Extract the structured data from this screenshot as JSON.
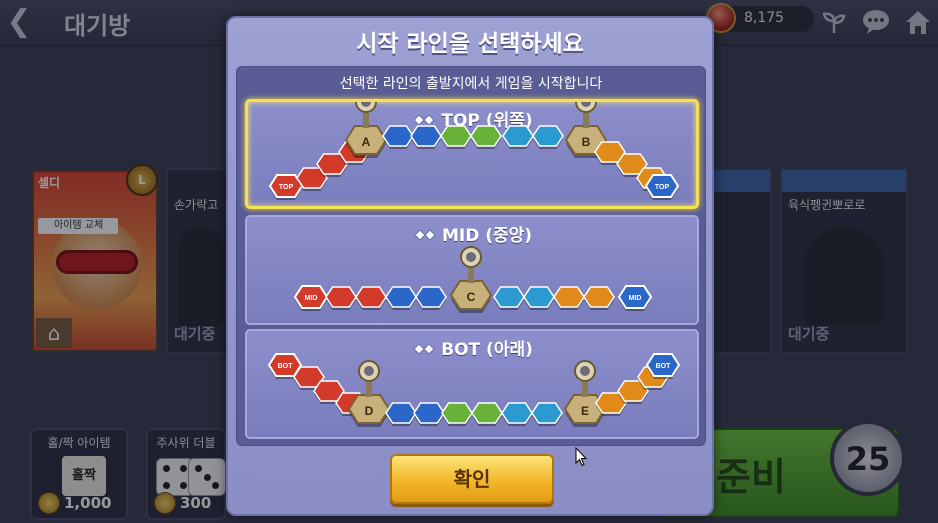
{
  "header": {
    "back_icon": "chevron-left-icon",
    "title": "대기방",
    "gem_amount": "8,175",
    "icons": [
      "sprout-icon",
      "chat-bubble-icon",
      "home-icon"
    ]
  },
  "players": [
    {
      "name": "셀디",
      "swap_label": "아이템 교체",
      "level_badge": "lv-icon"
    },
    {
      "name": "손가락고",
      "status": "대기중"
    },
    {
      "name": "육식펭귄뽀로로",
      "status": "대기중"
    }
  ],
  "items": {
    "oddeven": {
      "title": "홀/짝 아이템",
      "card": "홀짝",
      "price": "1,000"
    },
    "dice": {
      "title": "주사위 더블",
      "price": "300"
    }
  },
  "ready": {
    "label": "준비",
    "timer": "25"
  },
  "modal": {
    "title": "시작 라인을 선택하세요",
    "subtitle": "선택한 라인의 출발지에서 게임을 시작합니다",
    "lanes": [
      {
        "id": "top",
        "label": "TOP (위쪽)",
        "selected": true,
        "start_tag": "TOP",
        "end_tag": "TOP",
        "bases": [
          "A",
          "B"
        ]
      },
      {
        "id": "mid",
        "label": "MID (중앙)",
        "selected": false,
        "start_tag": "MID",
        "end_tag": "MID",
        "bases": [
          "C"
        ]
      },
      {
        "id": "bot",
        "label": "BOT (아래)",
        "selected": false,
        "start_tag": "BOT",
        "end_tag": "BOT",
        "bases": [
          "D",
          "E"
        ]
      }
    ],
    "confirm_label": "확인"
  },
  "colors": {
    "red": "#d23a2a",
    "blue": "#2a67c8",
    "green": "#68b23a",
    "cyan": "#2a9ad0",
    "orange": "#e08a1a",
    "selected_border": "#f5e050"
  }
}
